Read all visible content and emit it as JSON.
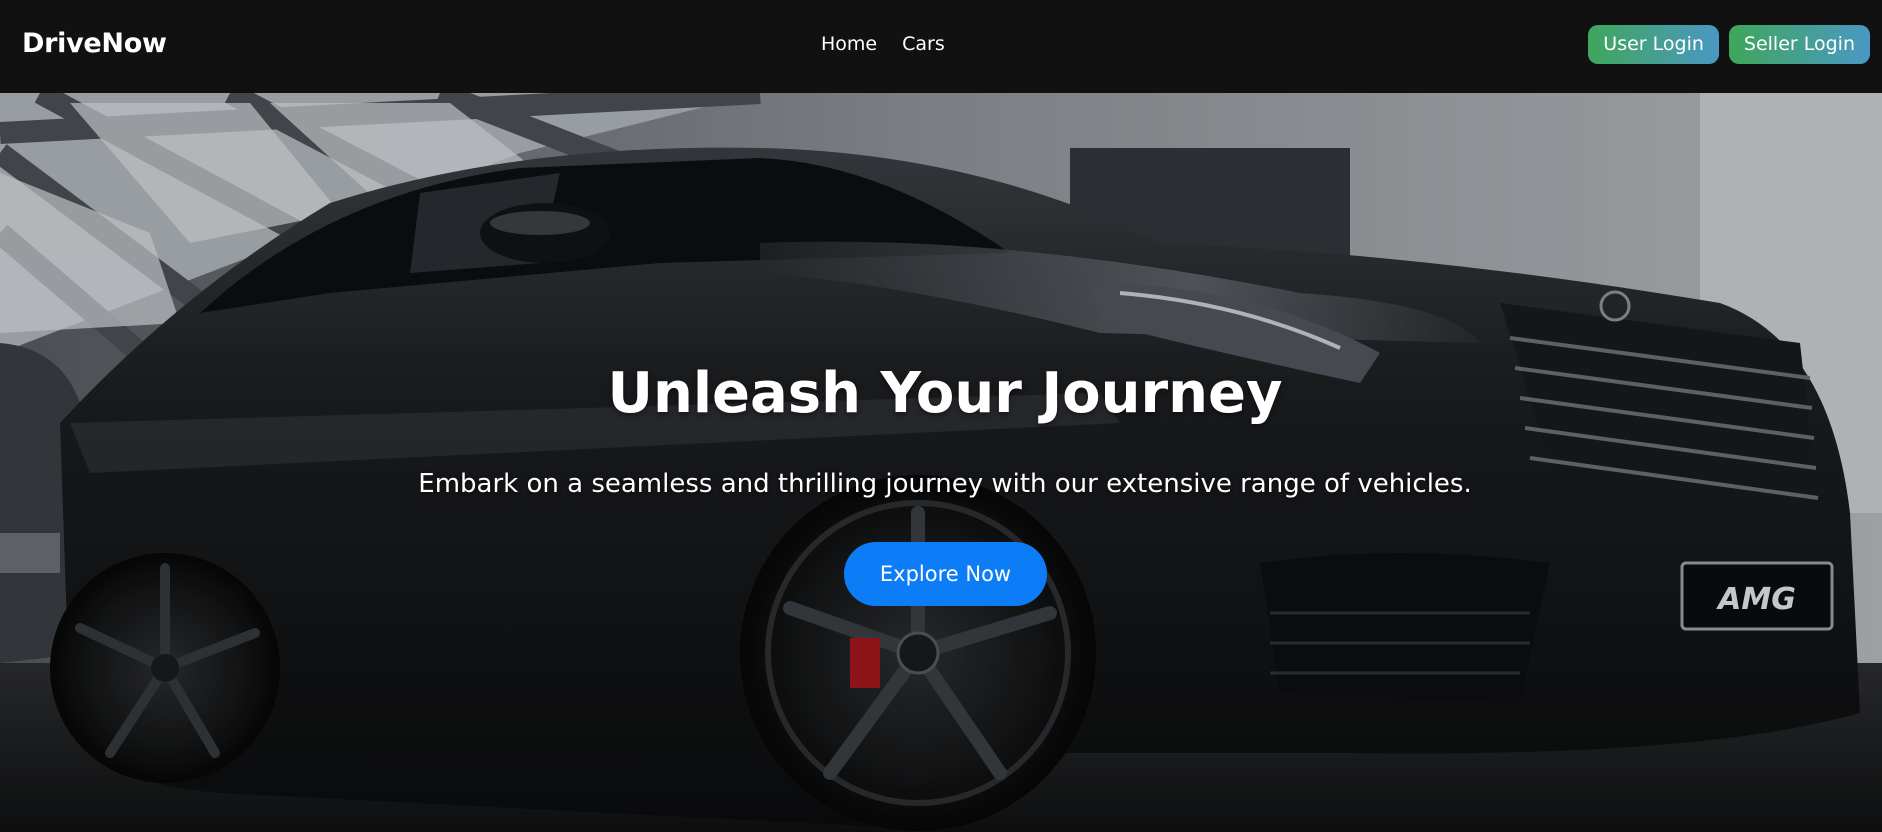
{
  "navbar": {
    "brand": "DriveNow",
    "links": [
      {
        "label": "Home"
      },
      {
        "label": "Cars"
      }
    ],
    "user_login": "User Login",
    "seller_login": "Seller Login"
  },
  "hero": {
    "title": "Unleash Your Journey",
    "subtitle": "Embark on a seamless and thrilling journey with our extensive range of vehicles.",
    "cta_label": "Explore Now",
    "plate_text": "AMG"
  },
  "colors": {
    "navbar_bg": "#111111",
    "cta": "#0d7df7",
    "login_gradient_start": "#3fa65a",
    "login_gradient_end": "#4a98c4"
  }
}
